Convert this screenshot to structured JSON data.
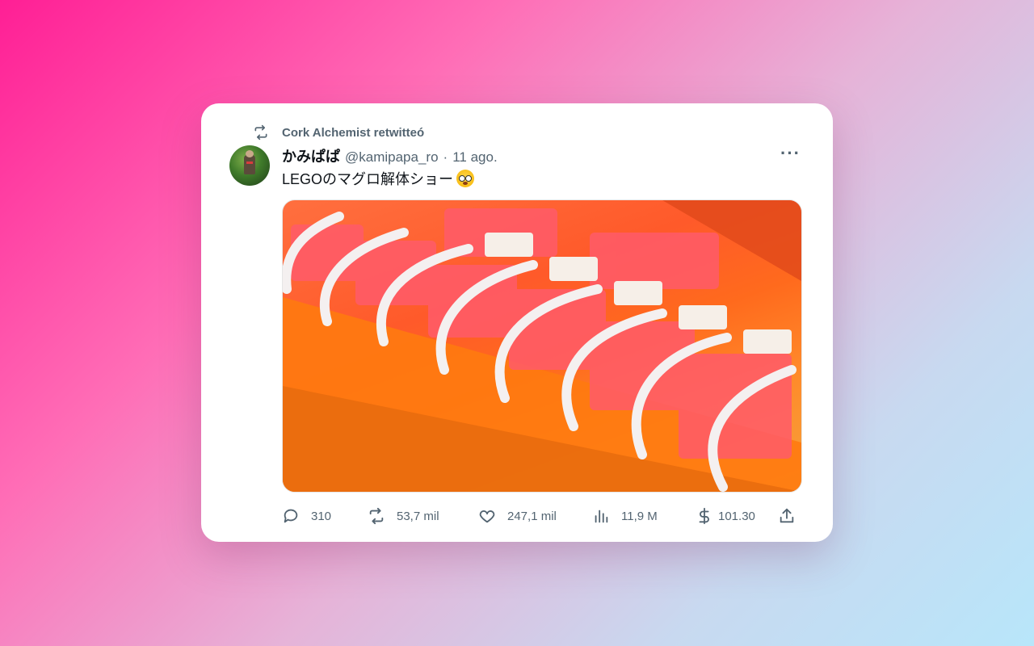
{
  "retweet": {
    "icon": "retweet-icon",
    "label": "Cork Alchemist retwitteó"
  },
  "author": {
    "display_name": "かみぱぱ",
    "handle": "@kamipapa_ro",
    "separator": "·",
    "time": "11 ago."
  },
  "tweet": {
    "text": "LEGOのマグロ解体ショー",
    "emoji": "flushed-face-icon"
  },
  "media": {
    "description_icon": "lego-tuna-skeleton-image"
  },
  "actions": {
    "reply": {
      "icon": "reply-icon",
      "count": "310"
    },
    "retweet": {
      "icon": "retweet-icon",
      "count": "53,7 mil"
    },
    "like": {
      "icon": "heart-icon",
      "count": "247,1 mil"
    },
    "views": {
      "icon": "bar-chart-icon",
      "count": "11,9 M"
    },
    "tip": {
      "icon": "dollar-icon",
      "count": "101.30"
    },
    "share": {
      "icon": "share-icon"
    }
  },
  "colors": {
    "secondary_text": "#536471",
    "primary_text": "#0f1419"
  }
}
